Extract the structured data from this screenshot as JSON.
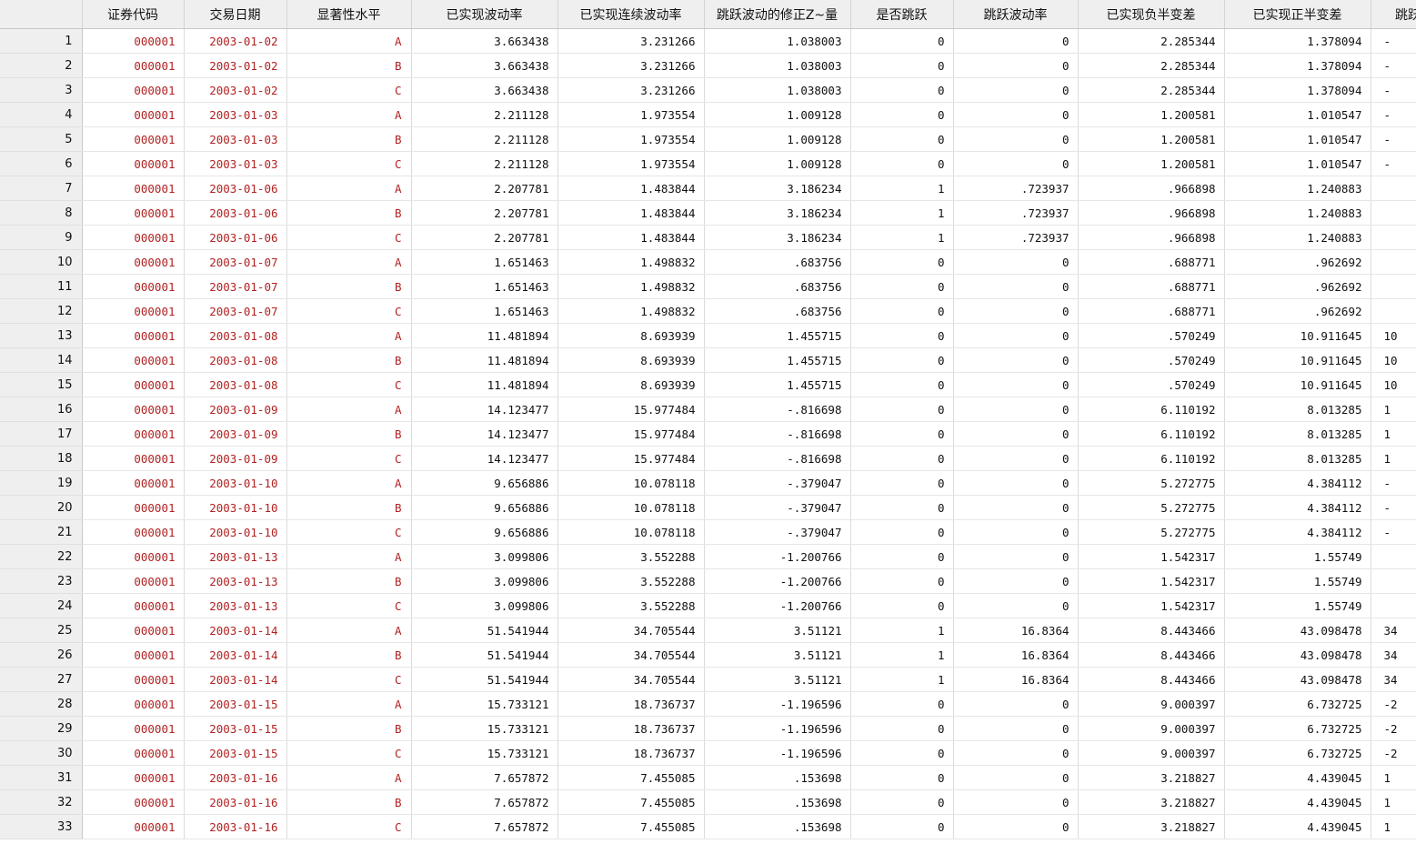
{
  "columns": [
    "证券代码",
    "交易日期",
    "显著性水平",
    "已实现波动率",
    "已实现连续波动率",
    "跳跃波动的修正Z~量",
    "是否跳跃",
    "跳跃波动率",
    "已实现负半变差",
    "已实现正半变差",
    "跳跃"
  ],
  "rows": [
    {
      "n": "1",
      "code": "000001",
      "date": "2003-01-02",
      "lvl": "A",
      "rv": "3.663438",
      "rcv": "3.231266",
      "z": "1.038003",
      "jump": "0",
      "jv": "0",
      "neg": "2.285344",
      "pos": "1.378094",
      "cut": "-"
    },
    {
      "n": "2",
      "code": "000001",
      "date": "2003-01-02",
      "lvl": "B",
      "rv": "3.663438",
      "rcv": "3.231266",
      "z": "1.038003",
      "jump": "0",
      "jv": "0",
      "neg": "2.285344",
      "pos": "1.378094",
      "cut": "-"
    },
    {
      "n": "3",
      "code": "000001",
      "date": "2003-01-02",
      "lvl": "C",
      "rv": "3.663438",
      "rcv": "3.231266",
      "z": "1.038003",
      "jump": "0",
      "jv": "0",
      "neg": "2.285344",
      "pos": "1.378094",
      "cut": "-"
    },
    {
      "n": "4",
      "code": "000001",
      "date": "2003-01-03",
      "lvl": "A",
      "rv": "2.211128",
      "rcv": "1.973554",
      "z": "1.009128",
      "jump": "0",
      "jv": "0",
      "neg": "1.200581",
      "pos": "1.010547",
      "cut": "-"
    },
    {
      "n": "5",
      "code": "000001",
      "date": "2003-01-03",
      "lvl": "B",
      "rv": "2.211128",
      "rcv": "1.973554",
      "z": "1.009128",
      "jump": "0",
      "jv": "0",
      "neg": "1.200581",
      "pos": "1.010547",
      "cut": "-"
    },
    {
      "n": "6",
      "code": "000001",
      "date": "2003-01-03",
      "lvl": "C",
      "rv": "2.211128",
      "rcv": "1.973554",
      "z": "1.009128",
      "jump": "0",
      "jv": "0",
      "neg": "1.200581",
      "pos": "1.010547",
      "cut": "-"
    },
    {
      "n": "7",
      "code": "000001",
      "date": "2003-01-06",
      "lvl": "A",
      "rv": "2.207781",
      "rcv": "1.483844",
      "z": "3.186234",
      "jump": "1",
      "jv": ".723937",
      "neg": ".966898",
      "pos": "1.240883",
      "cut": ""
    },
    {
      "n": "8",
      "code": "000001",
      "date": "2003-01-06",
      "lvl": "B",
      "rv": "2.207781",
      "rcv": "1.483844",
      "z": "3.186234",
      "jump": "1",
      "jv": ".723937",
      "neg": ".966898",
      "pos": "1.240883",
      "cut": ""
    },
    {
      "n": "9",
      "code": "000001",
      "date": "2003-01-06",
      "lvl": "C",
      "rv": "2.207781",
      "rcv": "1.483844",
      "z": "3.186234",
      "jump": "1",
      "jv": ".723937",
      "neg": ".966898",
      "pos": "1.240883",
      "cut": ""
    },
    {
      "n": "10",
      "code": "000001",
      "date": "2003-01-07",
      "lvl": "A",
      "rv": "1.651463",
      "rcv": "1.498832",
      "z": ".683756",
      "jump": "0",
      "jv": "0",
      "neg": ".688771",
      "pos": ".962692",
      "cut": ""
    },
    {
      "n": "11",
      "code": "000001",
      "date": "2003-01-07",
      "lvl": "B",
      "rv": "1.651463",
      "rcv": "1.498832",
      "z": ".683756",
      "jump": "0",
      "jv": "0",
      "neg": ".688771",
      "pos": ".962692",
      "cut": ""
    },
    {
      "n": "12",
      "code": "000001",
      "date": "2003-01-07",
      "lvl": "C",
      "rv": "1.651463",
      "rcv": "1.498832",
      "z": ".683756",
      "jump": "0",
      "jv": "0",
      "neg": ".688771",
      "pos": ".962692",
      "cut": ""
    },
    {
      "n": "13",
      "code": "000001",
      "date": "2003-01-08",
      "lvl": "A",
      "rv": "11.481894",
      "rcv": "8.693939",
      "z": "1.455715",
      "jump": "0",
      "jv": "0",
      "neg": ".570249",
      "pos": "10.911645",
      "cut": "10"
    },
    {
      "n": "14",
      "code": "000001",
      "date": "2003-01-08",
      "lvl": "B",
      "rv": "11.481894",
      "rcv": "8.693939",
      "z": "1.455715",
      "jump": "0",
      "jv": "0",
      "neg": ".570249",
      "pos": "10.911645",
      "cut": "10"
    },
    {
      "n": "15",
      "code": "000001",
      "date": "2003-01-08",
      "lvl": "C",
      "rv": "11.481894",
      "rcv": "8.693939",
      "z": "1.455715",
      "jump": "0",
      "jv": "0",
      "neg": ".570249",
      "pos": "10.911645",
      "cut": "10"
    },
    {
      "n": "16",
      "code": "000001",
      "date": "2003-01-09",
      "lvl": "A",
      "rv": "14.123477",
      "rcv": "15.977484",
      "z": "-.816698",
      "jump": "0",
      "jv": "0",
      "neg": "6.110192",
      "pos": "8.013285",
      "cut": "1"
    },
    {
      "n": "17",
      "code": "000001",
      "date": "2003-01-09",
      "lvl": "B",
      "rv": "14.123477",
      "rcv": "15.977484",
      "z": "-.816698",
      "jump": "0",
      "jv": "0",
      "neg": "6.110192",
      "pos": "8.013285",
      "cut": "1"
    },
    {
      "n": "18",
      "code": "000001",
      "date": "2003-01-09",
      "lvl": "C",
      "rv": "14.123477",
      "rcv": "15.977484",
      "z": "-.816698",
      "jump": "0",
      "jv": "0",
      "neg": "6.110192",
      "pos": "8.013285",
      "cut": "1"
    },
    {
      "n": "19",
      "code": "000001",
      "date": "2003-01-10",
      "lvl": "A",
      "rv": "9.656886",
      "rcv": "10.078118",
      "z": "-.379047",
      "jump": "0",
      "jv": "0",
      "neg": "5.272775",
      "pos": "4.384112",
      "cut": "-"
    },
    {
      "n": "20",
      "code": "000001",
      "date": "2003-01-10",
      "lvl": "B",
      "rv": "9.656886",
      "rcv": "10.078118",
      "z": "-.379047",
      "jump": "0",
      "jv": "0",
      "neg": "5.272775",
      "pos": "4.384112",
      "cut": "-"
    },
    {
      "n": "21",
      "code": "000001",
      "date": "2003-01-10",
      "lvl": "C",
      "rv": "9.656886",
      "rcv": "10.078118",
      "z": "-.379047",
      "jump": "0",
      "jv": "0",
      "neg": "5.272775",
      "pos": "4.384112",
      "cut": "-"
    },
    {
      "n": "22",
      "code": "000001",
      "date": "2003-01-13",
      "lvl": "A",
      "rv": "3.099806",
      "rcv": "3.552288",
      "z": "-1.200766",
      "jump": "0",
      "jv": "0",
      "neg": "1.542317",
      "pos": "1.55749",
      "cut": ""
    },
    {
      "n": "23",
      "code": "000001",
      "date": "2003-01-13",
      "lvl": "B",
      "rv": "3.099806",
      "rcv": "3.552288",
      "z": "-1.200766",
      "jump": "0",
      "jv": "0",
      "neg": "1.542317",
      "pos": "1.55749",
      "cut": ""
    },
    {
      "n": "24",
      "code": "000001",
      "date": "2003-01-13",
      "lvl": "C",
      "rv": "3.099806",
      "rcv": "3.552288",
      "z": "-1.200766",
      "jump": "0",
      "jv": "0",
      "neg": "1.542317",
      "pos": "1.55749",
      "cut": ""
    },
    {
      "n": "25",
      "code": "000001",
      "date": "2003-01-14",
      "lvl": "A",
      "rv": "51.541944",
      "rcv": "34.705544",
      "z": "3.51121",
      "jump": "1",
      "jv": "16.8364",
      "neg": "8.443466",
      "pos": "43.098478",
      "cut": "34"
    },
    {
      "n": "26",
      "code": "000001",
      "date": "2003-01-14",
      "lvl": "B",
      "rv": "51.541944",
      "rcv": "34.705544",
      "z": "3.51121",
      "jump": "1",
      "jv": "16.8364",
      "neg": "8.443466",
      "pos": "43.098478",
      "cut": "34"
    },
    {
      "n": "27",
      "code": "000001",
      "date": "2003-01-14",
      "lvl": "C",
      "rv": "51.541944",
      "rcv": "34.705544",
      "z": "3.51121",
      "jump": "1",
      "jv": "16.8364",
      "neg": "8.443466",
      "pos": "43.098478",
      "cut": "34"
    },
    {
      "n": "28",
      "code": "000001",
      "date": "2003-01-15",
      "lvl": "A",
      "rv": "15.733121",
      "rcv": "18.736737",
      "z": "-1.196596",
      "jump": "0",
      "jv": "0",
      "neg": "9.000397",
      "pos": "6.732725",
      "cut": "-2"
    },
    {
      "n": "29",
      "code": "000001",
      "date": "2003-01-15",
      "lvl": "B",
      "rv": "15.733121",
      "rcv": "18.736737",
      "z": "-1.196596",
      "jump": "0",
      "jv": "0",
      "neg": "9.000397",
      "pos": "6.732725",
      "cut": "-2"
    },
    {
      "n": "30",
      "code": "000001",
      "date": "2003-01-15",
      "lvl": "C",
      "rv": "15.733121",
      "rcv": "18.736737",
      "z": "-1.196596",
      "jump": "0",
      "jv": "0",
      "neg": "9.000397",
      "pos": "6.732725",
      "cut": "-2"
    },
    {
      "n": "31",
      "code": "000001",
      "date": "2003-01-16",
      "lvl": "A",
      "rv": "7.657872",
      "rcv": "7.455085",
      "z": ".153698",
      "jump": "0",
      "jv": "0",
      "neg": "3.218827",
      "pos": "4.439045",
      "cut": "1"
    },
    {
      "n": "32",
      "code": "000001",
      "date": "2003-01-16",
      "lvl": "B",
      "rv": "7.657872",
      "rcv": "7.455085",
      "z": ".153698",
      "jump": "0",
      "jv": "0",
      "neg": "3.218827",
      "pos": "4.439045",
      "cut": "1"
    },
    {
      "n": "33",
      "code": "000001",
      "date": "2003-01-16",
      "lvl": "C",
      "rv": "7.657872",
      "rcv": "7.455085",
      "z": ".153698",
      "jump": "0",
      "jv": "0",
      "neg": "3.218827",
      "pos": "4.439045",
      "cut": "1"
    }
  ]
}
